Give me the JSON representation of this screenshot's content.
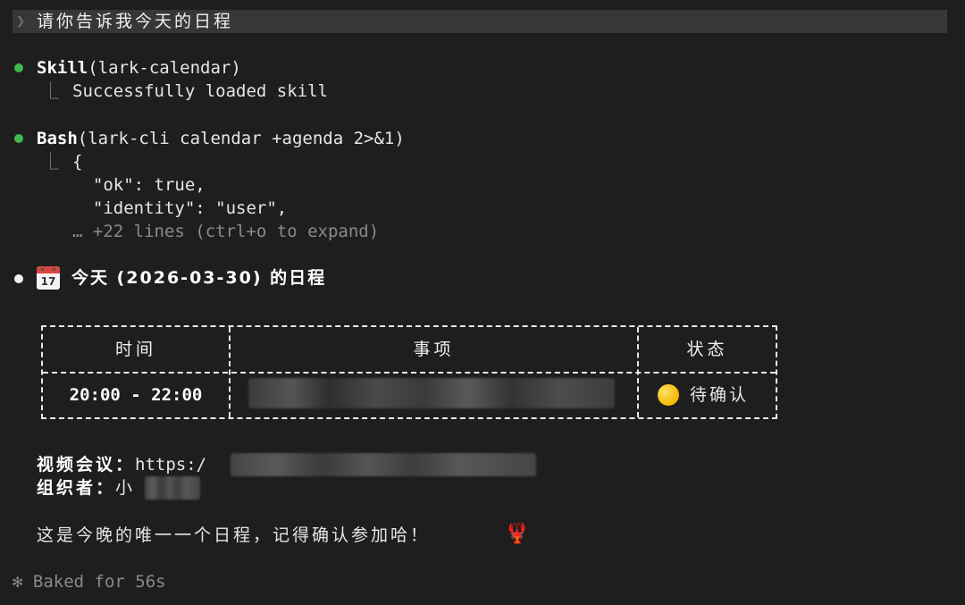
{
  "prompt": {
    "chevron": "❯",
    "text": "请你告诉我今天的日程"
  },
  "tool_calls": [
    {
      "name": "Skill",
      "args": "(lark-calendar)",
      "status_color": "#3fb950",
      "result": "Successfully loaded skill"
    },
    {
      "name": "Bash",
      "args": "(lark-cli calendar +agenda 2>&1)",
      "status_color": "#3fb950",
      "output_lines": [
        "{",
        "  \"ok\": true,",
        "  \"identity\": \"user\","
      ],
      "collapsed_note": "… +22 lines (ctrl+o to expand)"
    }
  ],
  "response": {
    "icon": "calendar-icon",
    "icon_date": "17",
    "heading": "今天 (2026-03-30) 的日程",
    "table": {
      "headers": [
        "时间",
        "事项",
        "状态"
      ],
      "rows": [
        {
          "time": "20:00 - 22:00",
          "event": "",
          "status_icon": "yellow-circle-icon",
          "status": "待确认"
        }
      ]
    },
    "meeting_label": "视频会议：",
    "meeting_link_visible": "https:/",
    "organizer_label": "组织者：",
    "organizer_visible": "小",
    "closing": "这是今晚的唯一一个日程，记得确认参加哈！",
    "closing_icon": "lobster-icon"
  },
  "footer": {
    "spinner": "✻",
    "text": "Baked for 56s"
  },
  "colors": {
    "background": "#1e1e1e",
    "prompt_bar": "#373737",
    "success": "#3fb950",
    "muted": "#8a8a8a"
  }
}
